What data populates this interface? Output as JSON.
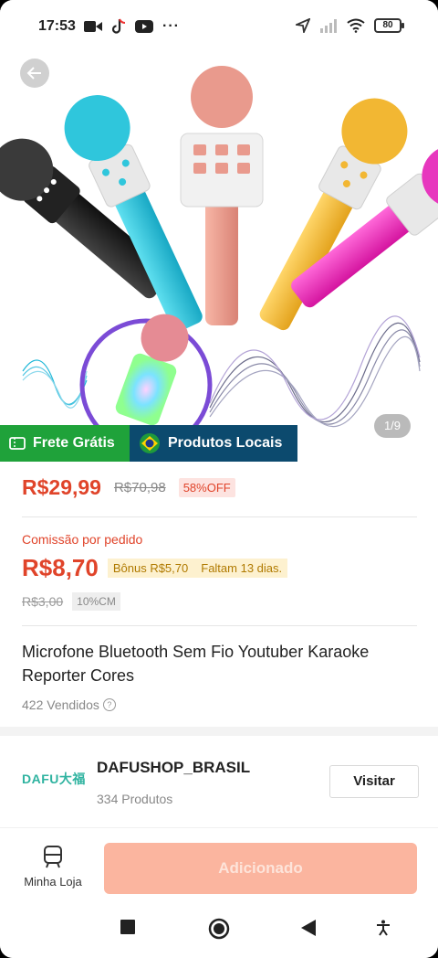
{
  "status_bar": {
    "time": "17:53",
    "battery": "80"
  },
  "gallery": {
    "counter": "1/9",
    "tags": {
      "frete": "Frete Grátis",
      "local": "Produtos Locais"
    }
  },
  "product": {
    "price": "R$29,99",
    "old_price": "R$70,98",
    "discount": "58%OFF",
    "title": "Microfone Bluetooth Sem Fio Youtuber Karaoke Reporter Cores",
    "sold": "422 Vendidos"
  },
  "commission": {
    "label": "Comissão por pedido",
    "value": "R$8,70",
    "bonus": "Bônus R$5,70",
    "remaining": "Faltam 13 dias.",
    "old_value": "R$3,00",
    "rate": "10%CM"
  },
  "shop": {
    "logo_text": "DAFU大福",
    "name": "DAFUSHOP_BRASIL",
    "products": "334 Produtos",
    "visit_label": "Visitar"
  },
  "bottom": {
    "my_store": "Minha Loja",
    "add_button": "Adicionado"
  },
  "colors": {
    "accent": "#e0442a",
    "frete_green": "#1fa23a",
    "local_blue": "#0c4a6e",
    "button_disabled": "#fbb59f"
  }
}
